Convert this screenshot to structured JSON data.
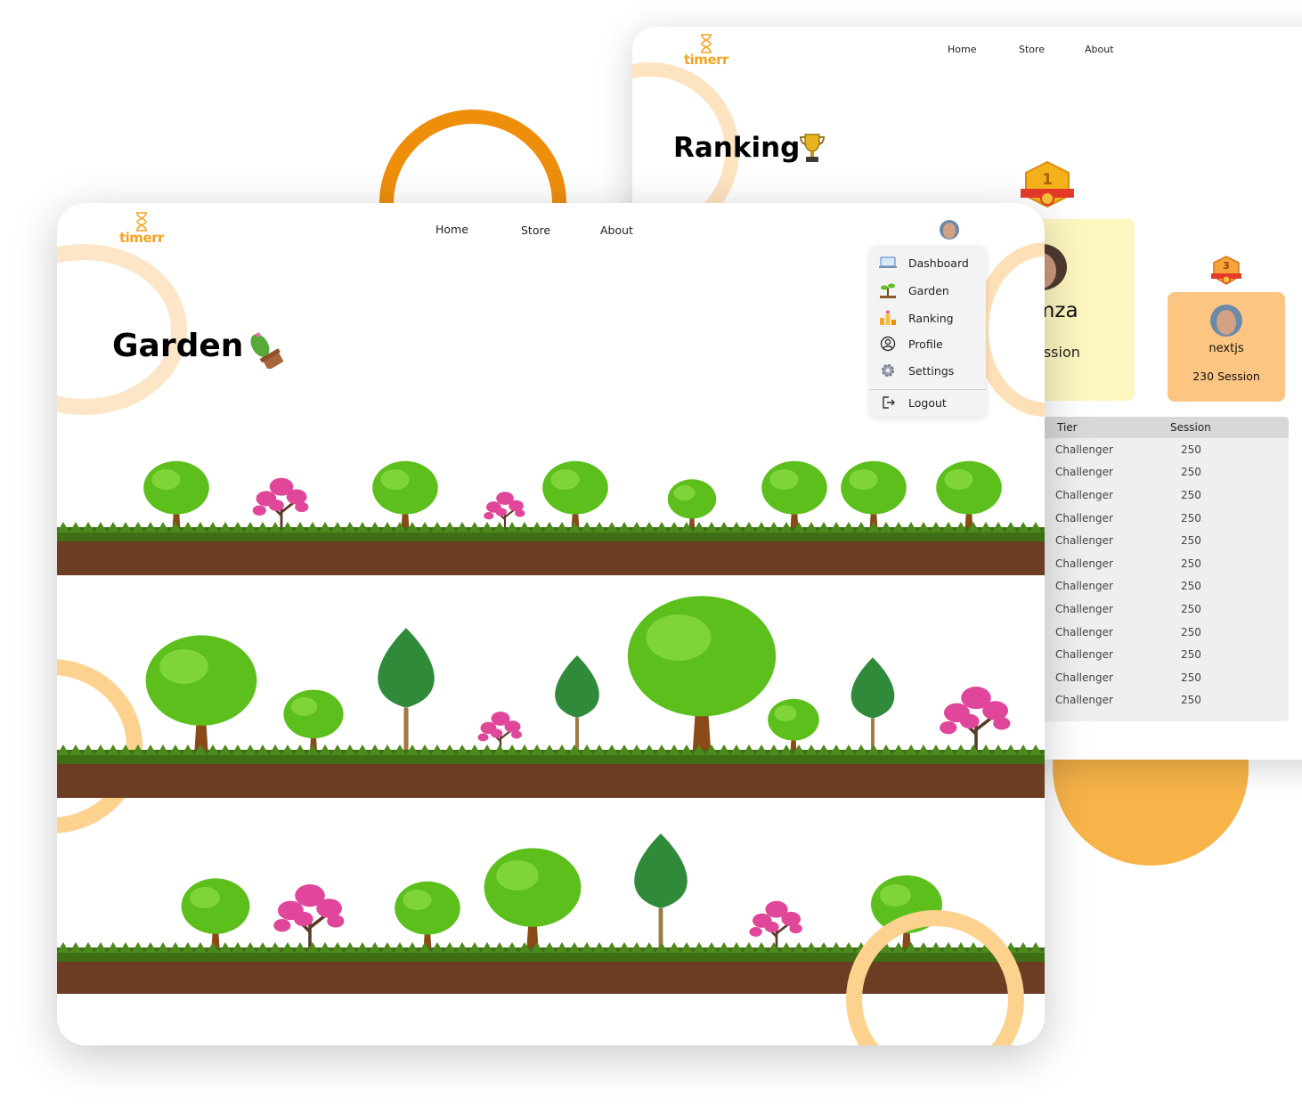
{
  "back_window": {
    "logo": "timerr",
    "nav": [
      "Home",
      "Store",
      "About"
    ],
    "title": "Ranking",
    "title_icon": "trophy-icon",
    "rank1": {
      "badge": "1",
      "name_partial": "mza",
      "session_partial": "ession"
    },
    "rank3": {
      "badge": "3",
      "name": "nextjs",
      "session": "230 Session"
    },
    "table": {
      "headers": [
        "Tier",
        "Session"
      ],
      "rows": [
        [
          "Challenger",
          "250"
        ],
        [
          "Challenger",
          "250"
        ],
        [
          "Challenger",
          "250"
        ],
        [
          "Challenger",
          "250"
        ],
        [
          "Challenger",
          "250"
        ],
        [
          "Challenger",
          "250"
        ],
        [
          "Challenger",
          "250"
        ],
        [
          "Challenger",
          "250"
        ],
        [
          "Challenger",
          "250"
        ],
        [
          "Challenger",
          "250"
        ],
        [
          "Challenger",
          "250"
        ],
        [
          "Challenger",
          "250"
        ]
      ]
    }
  },
  "front_window": {
    "logo": "timerr",
    "nav": [
      "Home",
      "Store",
      "About"
    ],
    "title": "Garden",
    "title_icon": "cactus-icon",
    "menu": {
      "items": [
        {
          "label": "Dashboard",
          "icon": "dashboard-icon"
        },
        {
          "label": "Garden",
          "icon": "garden-icon"
        },
        {
          "label": "Ranking",
          "icon": "ranking-icon"
        },
        {
          "label": "Profile",
          "icon": "profile-icon"
        },
        {
          "label": "Settings",
          "icon": "settings-icon"
        }
      ],
      "logout": {
        "label": "Logout",
        "icon": "logout-icon"
      }
    }
  },
  "colors": {
    "accent": "#f3a423",
    "ring_dark": "#ee8e0b",
    "disc": "#f8b449",
    "tree_green": "#5cbf1c",
    "blossom_pink": "#e0479a",
    "soil": "#6b3d22",
    "grass": "#3f6e16"
  }
}
